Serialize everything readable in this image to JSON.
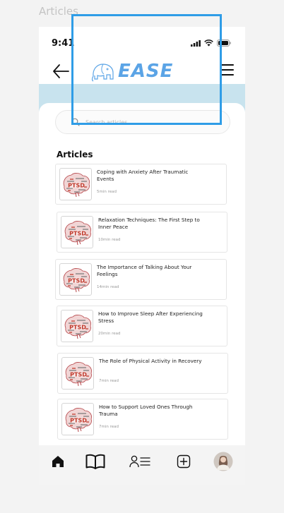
{
  "frame_label": "Articles",
  "status": {
    "time": "9:41"
  },
  "header": {
    "logo_text": "EASE"
  },
  "search": {
    "placeholder": "Search articles"
  },
  "section_title": "Articles",
  "thumb_label": "PTSD",
  "articles": [
    {
      "title": "Coping with Anxiety After Traumatic Events",
      "read_time": "5min read"
    },
    {
      "title": "Relaxation Techniques: The First Step to Inner Peace",
      "read_time": "10min read"
    },
    {
      "title": "The Importance of Talking About Your Feelings",
      "read_time": "14min read"
    },
    {
      "title": "How to Improve Sleep After Experiencing Stress",
      "read_time": "20min read"
    },
    {
      "title": "The Role of Physical Activity in Recovery",
      "read_time": "7min read"
    },
    {
      "title": "How to Support Loved Ones Through Trauma",
      "read_time": "7min read"
    }
  ],
  "nav": [
    {
      "icon": "home-icon",
      "active": true
    },
    {
      "icon": "book-icon",
      "active": false
    },
    {
      "icon": "contacts-list-icon",
      "active": false
    },
    {
      "icon": "add-square-icon",
      "active": false
    },
    {
      "icon": "avatar",
      "active": false
    }
  ],
  "colors": {
    "accent": "#5ba4e6",
    "banner": "#c8e3ee",
    "selection_outline": "#2f9de7"
  }
}
